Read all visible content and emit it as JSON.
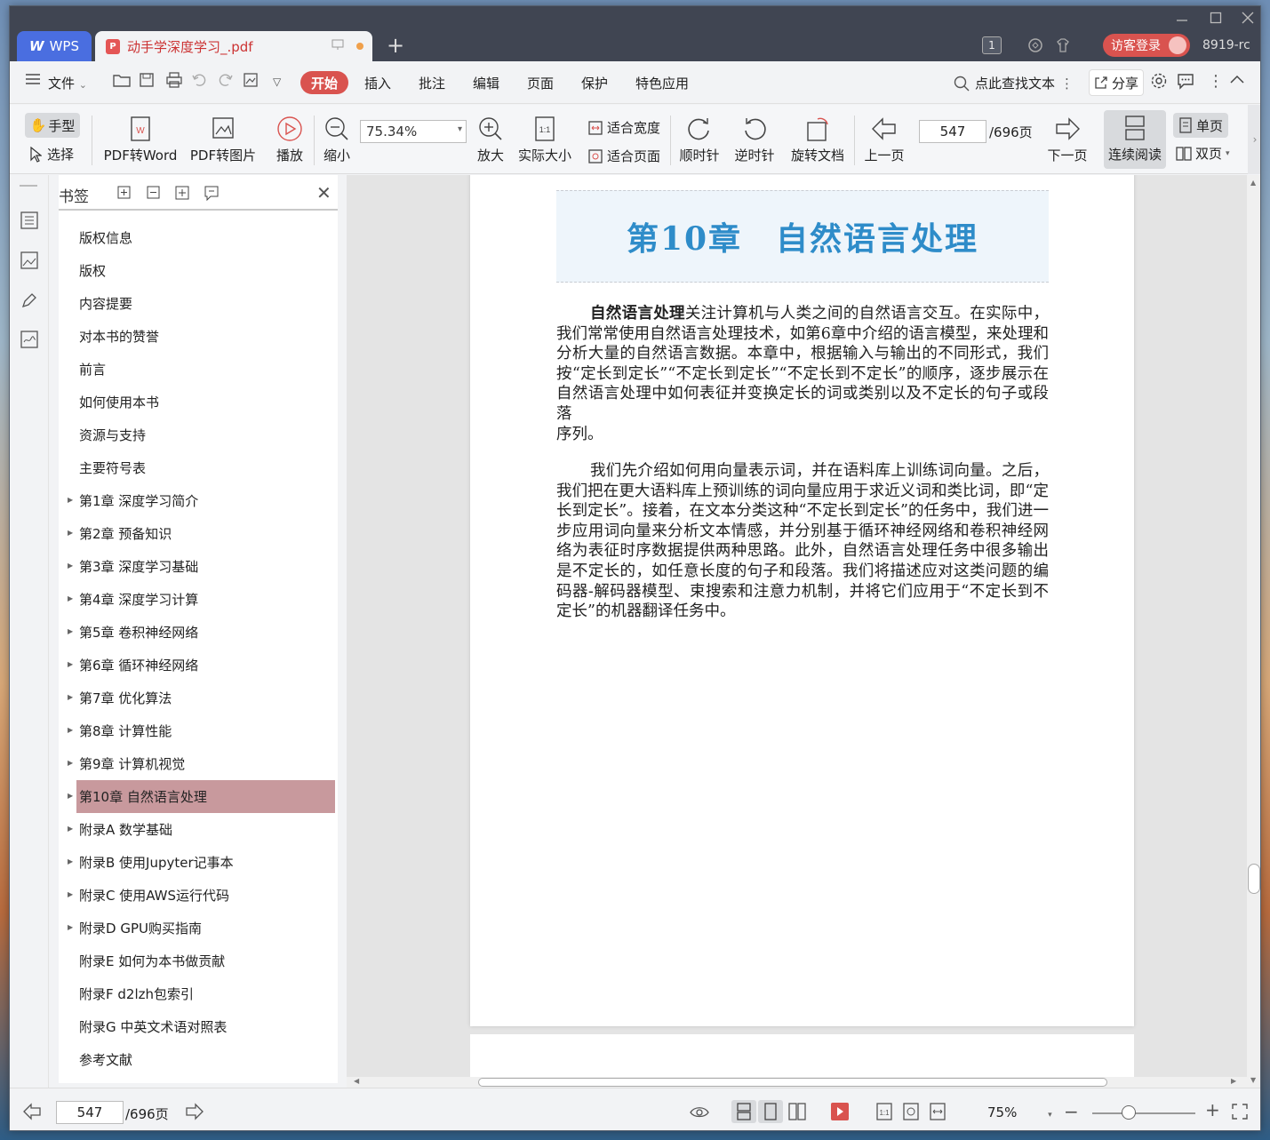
{
  "titlebar": {
    "wps_tab": "WPS",
    "doc_tab": "动手学深度学习_.pdf",
    "badge_count": "1",
    "login_label": "访客登录",
    "user_id": "8919-rc"
  },
  "menu": {
    "file": "文件",
    "start": "开始",
    "items": [
      "插入",
      "批注",
      "编辑",
      "页面",
      "保护",
      "特色应用"
    ],
    "search_text": "点此查找文本",
    "share": "分享"
  },
  "toolbar": {
    "hand": "手型",
    "select": "选择",
    "pdf_to_word": "PDF转Word",
    "pdf_to_image": "PDF转图片",
    "play": "播放",
    "zoom_out": "缩小",
    "zoom_value": "75.34%",
    "zoom_in": "放大",
    "actual_size": "实际大小",
    "fit_width": "适合宽度",
    "fit_page": "适合页面",
    "clockwise": "顺时针",
    "counter_clockwise": "逆时针",
    "rotate_doc": "旋转文档",
    "prev_page": "上一页",
    "page_current": "547",
    "page_total": "/696页",
    "next_page": "下一页",
    "continuous": "连续阅读",
    "single": "单页",
    "double": "双页"
  },
  "bookmarks": {
    "title": "书签",
    "items": [
      {
        "label": "版权信息",
        "expandable": false
      },
      {
        "label": "版权",
        "expandable": false
      },
      {
        "label": "内容提要",
        "expandable": false
      },
      {
        "label": "对本书的赞誉",
        "expandable": false
      },
      {
        "label": "前言",
        "expandable": false
      },
      {
        "label": "如何使用本书",
        "expandable": false
      },
      {
        "label": "资源与支持",
        "expandable": false
      },
      {
        "label": "主要符号表",
        "expandable": false
      },
      {
        "label": "第1章 深度学习简介",
        "expandable": true
      },
      {
        "label": "第2章 预备知识",
        "expandable": true
      },
      {
        "label": "第3章 深度学习基础",
        "expandable": true
      },
      {
        "label": "第4章 深度学习计算",
        "expandable": true
      },
      {
        "label": "第5章 卷积神经网络",
        "expandable": true
      },
      {
        "label": "第6章 循环神经网络",
        "expandable": true
      },
      {
        "label": "第7章 优化算法",
        "expandable": true
      },
      {
        "label": "第8章 计算性能",
        "expandable": true
      },
      {
        "label": "第9章 计算机视觉",
        "expandable": true
      },
      {
        "label": "第10章 自然语言处理",
        "expandable": true,
        "active": true
      },
      {
        "label": "附录A 数学基础",
        "expandable": true
      },
      {
        "label": "附录B 使用Jupyter记事本",
        "expandable": true
      },
      {
        "label": "附录C 使用AWS运行代码",
        "expandable": true
      },
      {
        "label": "附录D GPU购买指南",
        "expandable": true
      },
      {
        "label": "附录E 如何为本书做贡献",
        "expandable": false
      },
      {
        "label": "附录F d2lzh包索引",
        "expandable": false
      },
      {
        "label": "附录G 中英文术语对照表",
        "expandable": false
      },
      {
        "label": "参考文献",
        "expandable": false
      }
    ]
  },
  "document": {
    "chapter_title": "第10章　自然语言处理",
    "para1_bold": "自然语言处理",
    "para1_rest": "关注计算机与人类之间的自然语言交互。在实际中，我们常常使用自然语言处理技术，如第6章中介绍的语言模型，来处理和分析大量的自然语言数据。本章中，根据输入与输出的不同形式，我们按“定长到定长”“不定长到定长”“不定长到不定长”的顺序，逐步展示在自然语言处理中如何表征并变换定长的词或类别以及不定长的句子或段落",
    "para1_tail": "序列。",
    "para2": "我们先介绍如何用向量表示词，并在语料库上训练词向量。之后，我们把在更大语料库上预训练的词向量应用于求近义词和类比词，即“定长到定长”。接着，在文本分类这种“不定长到定长”的任务中，我们进一步应用词向量来分析文本情感，并分别基于循环神经网络和卷积神经网络为表征时序数据提供两种思路。此外，自然语言处理任务中很多输出是不定长的，如任意长度的句子和段落。我们将描述应对这类问题的编码器-解码器模型、束搜索和注意力机制，并将它们应用于“不定长到不定长”的机器翻译任务中。"
  },
  "statusbar": {
    "page_current": "547",
    "page_total": "/696页",
    "zoom": "75%"
  },
  "colors": {
    "accent_red": "#d9534f",
    "active_bookmark": "#c8999d",
    "chapter_blue": "#2e8cc9",
    "wps_blue": "#4a6ee0"
  }
}
